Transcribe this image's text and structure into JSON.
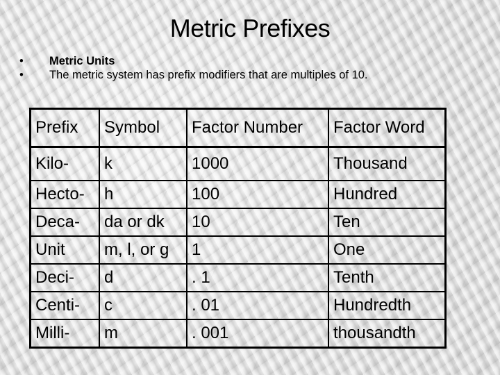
{
  "slide": {
    "title": "Metric Prefixes",
    "bullets": [
      {
        "text": "Metric Units",
        "bold": true
      },
      {
        "text": "The metric system has prefix modifiers that are multiples of 10.",
        "bold": false
      }
    ],
    "bullet_glyph": "•"
  },
  "table": {
    "headers": [
      "Prefix",
      "Symbol",
      "Factor Number",
      "Factor Word"
    ],
    "rows": [
      {
        "prefix": "Kilo-",
        "symbol": "k",
        "factor_number": "1000",
        "factor_word": "Thousand"
      },
      {
        "prefix": "Hecto-",
        "symbol": "h",
        "factor_number": "100",
        "factor_word": "Hundred"
      },
      {
        "prefix": "Deca-",
        "symbol": "da or dk",
        "factor_number": "10",
        "factor_word": "Ten"
      },
      {
        "prefix": "Unit",
        "symbol": "m, l, or g",
        "factor_number": "1",
        "factor_word": "One"
      },
      {
        "prefix": "Deci-",
        "symbol": "d",
        "factor_number": ". 1",
        "factor_word": "Tenth"
      },
      {
        "prefix": "Centi-",
        "symbol": "c",
        "factor_number": ". 01",
        "factor_word": "Hundredth"
      },
      {
        "prefix": "Milli-",
        "symbol": "m",
        "factor_number": ". 001",
        "factor_word": "thousandth"
      }
    ]
  }
}
